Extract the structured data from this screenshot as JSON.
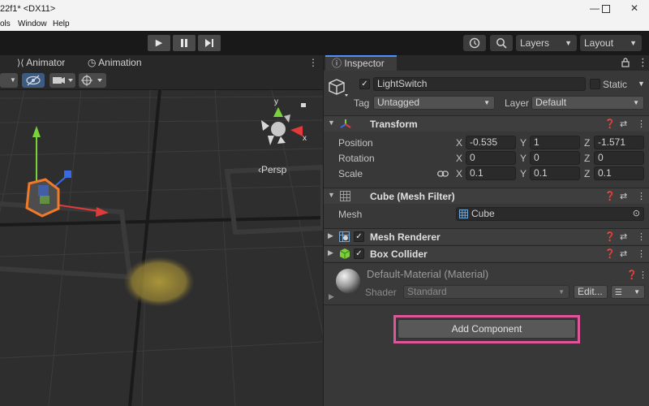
{
  "window": {
    "title": "22f1* <DX11>",
    "controls": [
      "—",
      "☐",
      "✕"
    ]
  },
  "menu": {
    "items": [
      "ols",
      "Window",
      "Help"
    ]
  },
  "toolbar": {
    "play_label": "▶",
    "pause_label": "❚❚",
    "step_label": "▶❚",
    "layers_label": "Layers",
    "layout_label": "Layout"
  },
  "scene": {
    "tabs": [
      "Animator",
      "Animation"
    ],
    "persp_label": "‹Persp",
    "gizmo_axes": {
      "y": "y",
      "x": "x"
    }
  },
  "inspector": {
    "tab_label": "Inspector",
    "object": {
      "active": true,
      "name": "LightSwitch",
      "static_label": "Static",
      "tag_label": "Tag",
      "tag_value": "Untagged",
      "layer_label": "Layer",
      "layer_value": "Default"
    },
    "transform": {
      "title": "Transform",
      "position_label": "Position",
      "rotation_label": "Rotation",
      "scale_label": "Scale",
      "axes": [
        "X",
        "Y",
        "Z"
      ],
      "position": [
        "-0.535",
        "1",
        "-1.571"
      ],
      "rotation": [
        "0",
        "0",
        "0"
      ],
      "scale": [
        "0.1",
        "0.1",
        "0.1"
      ]
    },
    "mesh_filter": {
      "title": "Cube (Mesh Filter)",
      "mesh_label": "Mesh",
      "mesh_value": "Cube"
    },
    "mesh_renderer": {
      "title": "Mesh Renderer",
      "enabled": true
    },
    "box_collider": {
      "title": "Box Collider",
      "enabled": true
    },
    "material": {
      "title": "Default-Material (Material)",
      "shader_label": "Shader",
      "shader_value": "Standard",
      "edit_label": "Edit..."
    },
    "add_component_label": "Add Component"
  },
  "colors": {
    "highlight": "#e0559a",
    "x_axis": "#e23a3a",
    "y_axis": "#79d23a",
    "z_axis": "#3a6ae2",
    "selection": "#f07a2a",
    "active_tab": "#4d90fe"
  },
  "icons": {
    "history": "history-icon",
    "search": "search-icon",
    "help": "help-icon",
    "preset": "preset-icon",
    "kebab": "kebab-menu-icon"
  }
}
